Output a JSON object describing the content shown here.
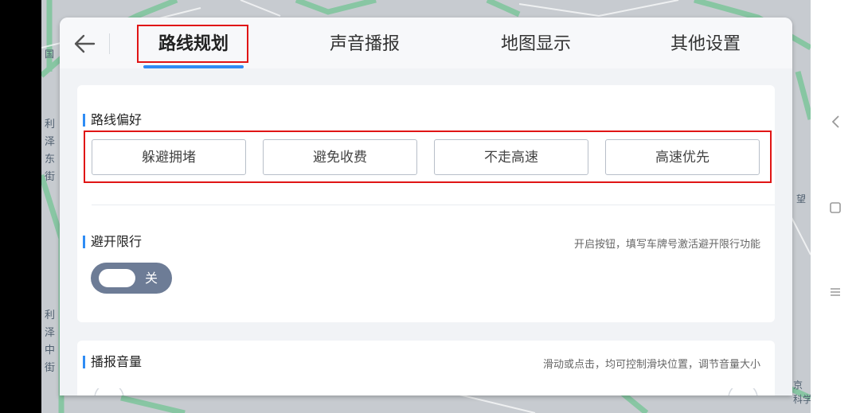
{
  "tabs": [
    {
      "label": "路线规划",
      "active": true
    },
    {
      "label": "声音播报",
      "active": false
    },
    {
      "label": "地图显示",
      "active": false
    },
    {
      "label": "其他设置",
      "active": false
    }
  ],
  "route_pref": {
    "title": "路线偏好",
    "options": [
      "躲避拥堵",
      "避免收费",
      "不走高速",
      "高速优先"
    ]
  },
  "avoid_restriction": {
    "title": "避开限行",
    "hint": "开启按钮，填写车牌号激活避开限行功能",
    "toggle_label": "关",
    "toggle_on": false
  },
  "volume": {
    "title": "播报音量",
    "hint": "滑动或点击，均可控制滑块位置，调节音量大小"
  },
  "map_labels": [
    "利",
    "泽",
    "东",
    "街",
    "利",
    "泽",
    "中",
    "街",
    "国",
    "京",
    "科学",
    "望"
  ],
  "colors": {
    "accent": "#2f8cf4",
    "highlight": "#e01515",
    "toggle_off": "#6d7c96"
  }
}
